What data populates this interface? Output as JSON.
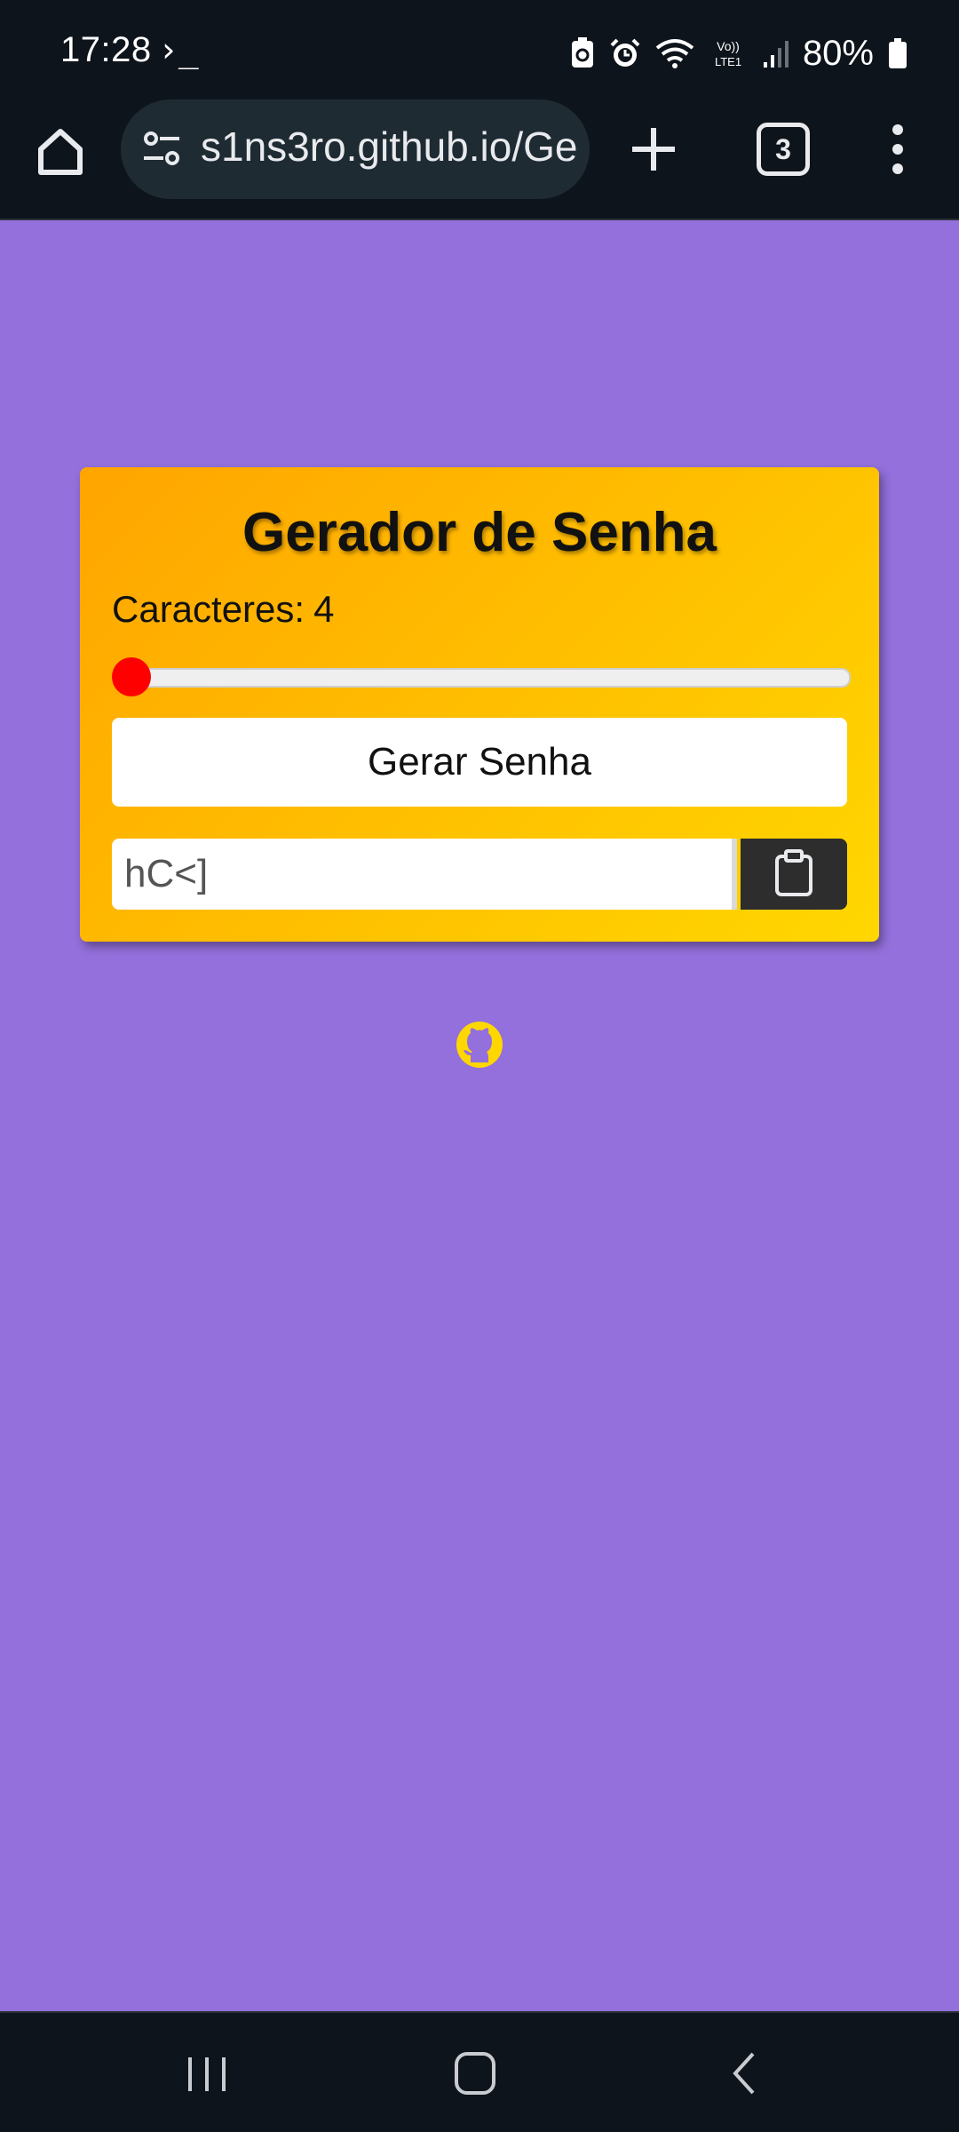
{
  "status_bar": {
    "time": "17:28",
    "terminal_glyph": "›_",
    "battery_percent": "80%"
  },
  "browser": {
    "url": "s1ns3ro.github.io/Ge",
    "tab_count": "3"
  },
  "card": {
    "title": "Gerador de Senha",
    "chars_label": "Caracteres:",
    "chars_value": "4",
    "slider_fraction": 0.0,
    "generate_label": "Gerar Senha",
    "password_value": "hC<]"
  },
  "colors": {
    "page_bg": "#9370db",
    "card_gradient_start": "#ffa500",
    "card_gradient_end": "#ffd700",
    "slider_thumb": "#ff0000",
    "copy_button": "#2d2d2d",
    "github_icon": "#ffd700"
  },
  "icons": {
    "home": "home-icon",
    "tune": "site-settings-icon",
    "new_tab": "plus-icon",
    "menu": "more-vert-icon",
    "copy": "clipboard-icon",
    "github": "github-icon"
  }
}
